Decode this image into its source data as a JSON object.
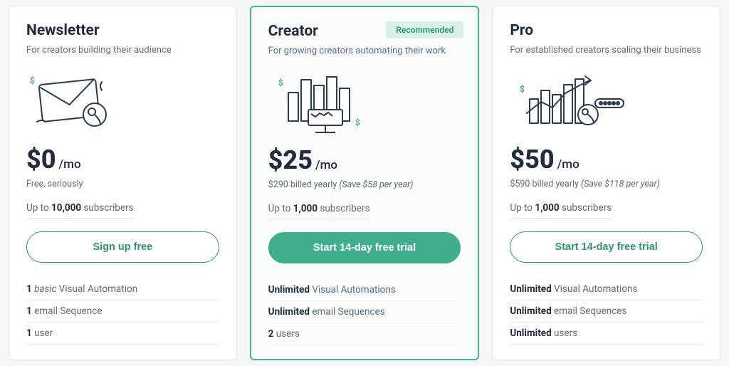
{
  "plans": [
    {
      "id": "newsletter",
      "title": "Newsletter",
      "subtitle": "For creators building their audience",
      "price": "$0",
      "per": "/mo",
      "note": "Free, seriously",
      "save": "",
      "subs_prefix": "Up to ",
      "subs_count": "10,000",
      "subs_suffix": " subscribers",
      "cta": "Sign up free",
      "cta_style": "outline",
      "badge": "",
      "features": [
        {
          "bold": "1",
          "italic": " basic ",
          "rest": "Visual Automation"
        },
        {
          "bold": "1",
          "italic": "",
          "rest": " email Sequence"
        },
        {
          "bold": "1",
          "italic": "",
          "rest": " user"
        }
      ]
    },
    {
      "id": "creator",
      "title": "Creator",
      "subtitle": "For growing creators automating their work",
      "price": "$25",
      "per": "/mo",
      "note": "$290 billed yearly ",
      "save": "(Save $58 per year)",
      "subs_prefix": "Up to ",
      "subs_count": "1,000",
      "subs_suffix": " subscribers",
      "cta": "Start 14-day free trial",
      "cta_style": "solid",
      "badge": "Recommended",
      "features": [
        {
          "bold": "Unlimited",
          "italic": "",
          "rest": " Visual Automations"
        },
        {
          "bold": "Unlimited",
          "italic": "",
          "rest": " email Sequences"
        },
        {
          "bold": "2",
          "italic": "",
          "rest": " users"
        }
      ]
    },
    {
      "id": "pro",
      "title": "Pro",
      "subtitle": "For established creators scaling their business",
      "price": "$50",
      "per": "/mo",
      "note": "$590 billed yearly ",
      "save": "(Save $118 per year)",
      "subs_prefix": "Up to ",
      "subs_count": "1,000",
      "subs_suffix": " subscribers",
      "cta": "Start 14-day free trial",
      "cta_style": "outline",
      "badge": "",
      "features": [
        {
          "bold": "Unlimited",
          "italic": "",
          "rest": " Visual Automations"
        },
        {
          "bold": "Unlimited",
          "italic": "",
          "rest": " email Sequences"
        },
        {
          "bold": "Unlimited",
          "italic": "",
          "rest": " users"
        }
      ]
    }
  ]
}
